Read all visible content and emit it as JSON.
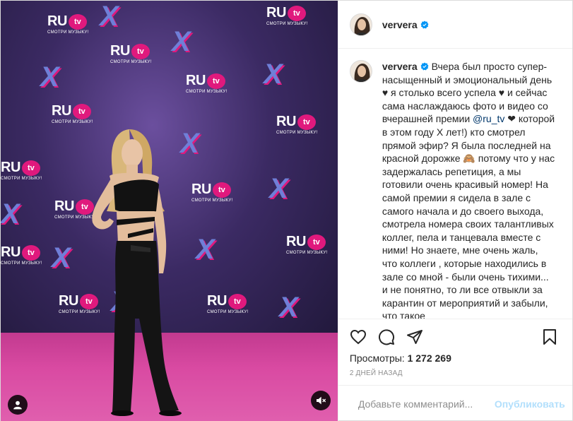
{
  "colors": {
    "accent": "#0095f6",
    "accent_disabled": "#b2dffc",
    "backdrop": "#3b2a63",
    "carpet": "#d94aa2",
    "brand_pink": "#e0197d"
  },
  "media": {
    "logos": [
      {
        "ru": "RU",
        "tv": "tv",
        "sub": "СМОТРИ МУЗЫКУ!"
      }
    ],
    "x_mark": "X",
    "avatar_icon": "user-icon",
    "mute_icon": "sound-off-icon"
  },
  "header": {
    "username": "ververa",
    "verified_icon": "verified-badge-icon"
  },
  "caption": {
    "username": "ververa",
    "text_before": "Вчера был просто супер-насыщенный и эмоциональный день ♥ я столько всего успела ♥ и сейчас сама наслаждаюсь фото и видео со вчерашней премии",
    "mention": "@ru_tv",
    "text_after": "❤ которой в этом году X лет!) кто смотрел прямой эфир? Я была последней на красной дорожке 🙈 потому что у нас задержалась репетиция, а мы готовили очень красивый номер! На самой премии я сидела в зале с самого начала и до своего выхода, смотрела номера своих талантливых коллег, пела и танцевала вместе с ними! Но знаете, мне очень жаль, что коллеги , которые находились в зале со мной - были очень тихими... и не понятно, то ли все отвыкли за карантин от мероприятий и забыли, что такое"
  },
  "actions": {
    "like_icon": "heart-icon",
    "comment_icon": "comment-icon",
    "share_icon": "send-icon",
    "save_icon": "bookmark-icon"
  },
  "stats": {
    "views_label": "Просмотры:",
    "views_value": "1 272 269",
    "timestamp": "2 дней назад"
  },
  "comment": {
    "emoji_icon": "smiley-icon",
    "placeholder": "Добавьте комментарий...",
    "post_label": "Опубликовать"
  }
}
